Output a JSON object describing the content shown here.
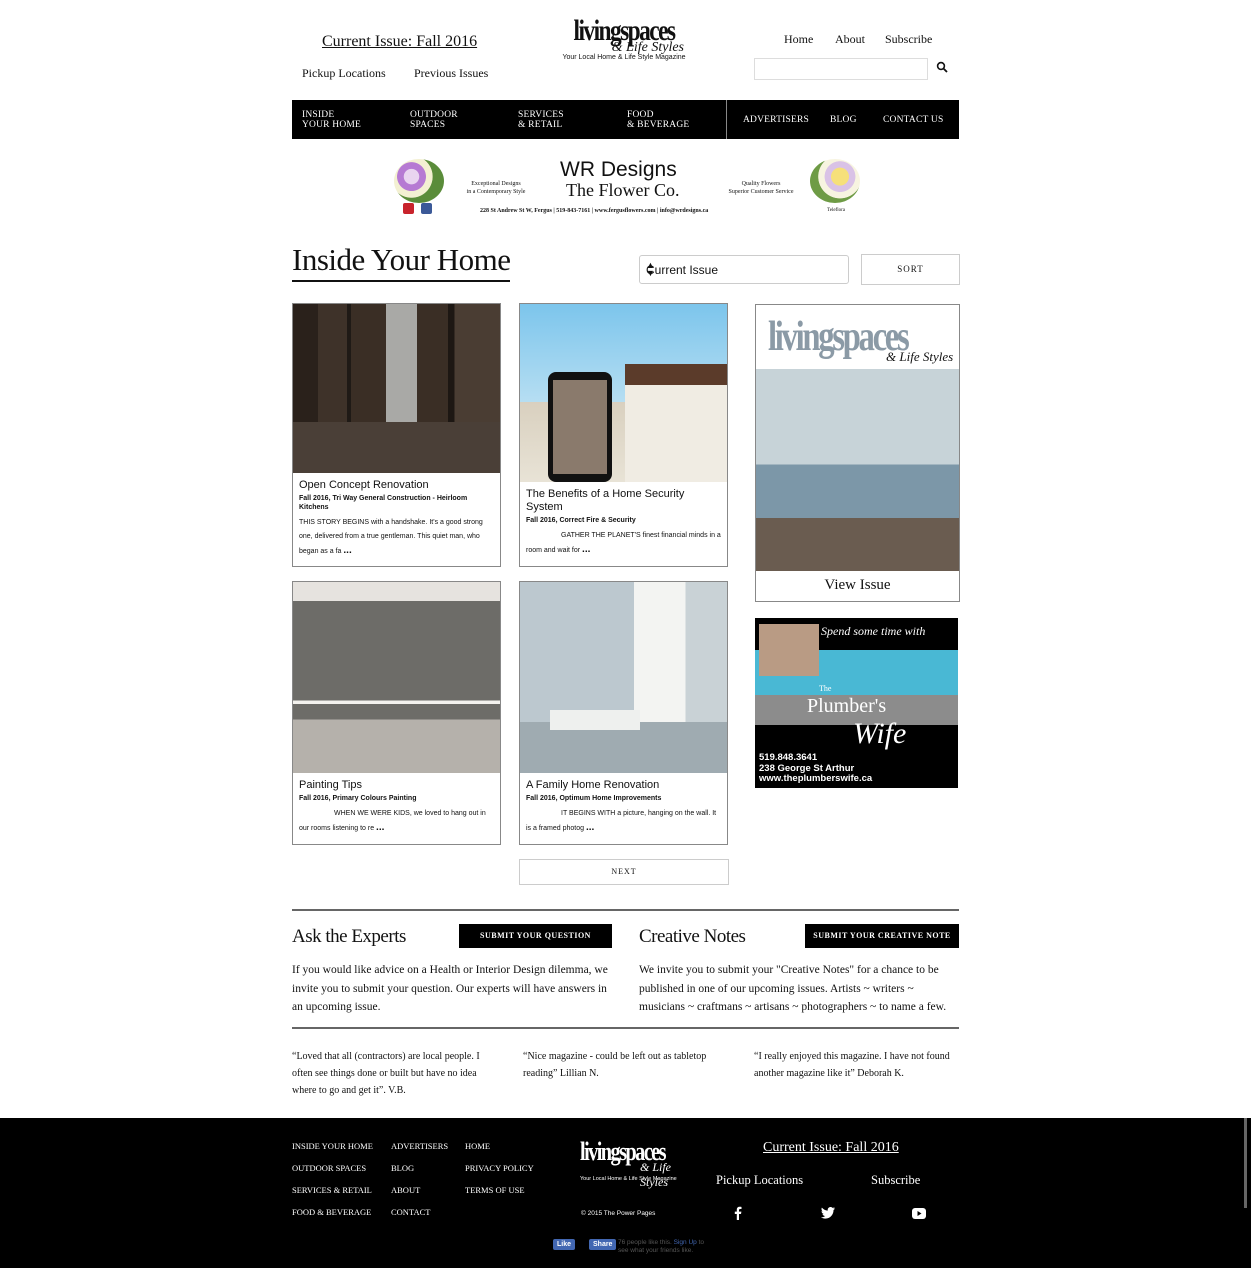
{
  "header": {
    "current_issue": "Current Issue: Fall 2016",
    "pickup_locations": "Pickup Locations",
    "previous_issues": "Previous Issues",
    "logo_word": "livingspaces",
    "logo_script": "& Life Styles",
    "logo_tagline": "Your Local Home & Life Style Magazine",
    "nav": {
      "home": "Home",
      "about": "About",
      "subscribe": "Subscribe"
    },
    "search_placeholder": ""
  },
  "navbar": {
    "inside_home_1": "INSIDE",
    "inside_home_2": "YOUR HOME",
    "outdoor_1": "OUTDOOR",
    "outdoor_2": "SPACES",
    "services_1": "SERVICES",
    "services_2": "& RETAIL",
    "food_1": "FOOD",
    "food_2": "& BEVERAGE",
    "advertisers": "ADVERTISERS",
    "blog": "BLOG",
    "contact": "CONTACT US"
  },
  "ad_banner": {
    "title": "WR Designs",
    "subtitle": "The Flower Co.",
    "left_text_1": "Exceptional Designs",
    "left_text_2": "in a Contemporary Style",
    "right_text_1": "Quality Flowers",
    "right_text_2": "Superior Customer Service",
    "address": "228 St Andrew St W, Fergus  |  519-843-7161  |  www.fergusflowers.com  |  info@wrdesigns.ca",
    "teleflora": "Teleflora"
  },
  "section": {
    "title": "Inside Your Home",
    "filter_value": "Current Issue",
    "sort_label": "SORT"
  },
  "articles": [
    {
      "title": "Open Concept Renovation",
      "meta": "Fall 2016, Tri Way General Construction - Heirloom Kitchens",
      "excerpt": "THIS STORY BEGINS with a handshake. It's a good strong one, delivered from a true gentleman. This quiet man, who began as a fa"
    },
    {
      "title": "The Benefits of a Home Security System",
      "meta": "Fall 2016, Correct Fire & Security",
      "excerpt": "GATHER THE PLANET'S finest financial minds in a room and wait for"
    },
    {
      "title": "Painting Tips",
      "meta": "Fall 2016, Primary Colours Painting",
      "excerpt": "WHEN WE WERE KIDS, we loved to hang out in our rooms listening to re"
    },
    {
      "title": "A Family Home Renovation",
      "meta": "Fall 2016, Optimum Home Improvements",
      "excerpt": "IT BEGINS WITH a picture, hanging on the wall. It is a framed photog"
    }
  ],
  "more": "...",
  "next_label": "NEXT",
  "magazine": {
    "cover_word": "livingspaces",
    "cover_script": "& Life Styles",
    "view_label": "View Issue"
  },
  "plumber_ad": {
    "headline": "Spend some time with",
    "brand_1": "The",
    "brand_2": "Plumber's",
    "brand_3": "Wife",
    "phone": "519.848.3641",
    "address": "238 George St Arthur",
    "web": "www.theplumberswife.ca"
  },
  "experts": {
    "title": "Ask the Experts",
    "button": "SUBMIT YOUR QUESTION",
    "text": "If you would like advice on a Health or Interior Design dilemma, we invite you to submit your question. Our experts will have answers in an upcoming issue."
  },
  "creative": {
    "title": "Creative Notes",
    "button": "SUBMIT YOUR CREATIVE NOTE",
    "text": "We invite you to submit your \"Creative Notes\" for a chance to be published in one of our upcoming issues. Artists ~ writers ~ musicians ~ craftmans ~ artisans ~ photographers ~ to name a few."
  },
  "quotes": [
    "“Loved that all (contractors) are local people. I often see things done or built but have no idea where to go and get it”. V.B.",
    "“Nice magazine - could be left out as tabletop reading” Lillian N.",
    "“I really enjoyed this magazine. I have not found another magazine like it” Deborah K."
  ],
  "footer": {
    "col1": [
      "INSIDE YOUR HOME",
      "OUTDOOR SPACES",
      "SERVICES & RETAIL",
      "FOOD & BEVERAGE"
    ],
    "col2": [
      "ADVERTISERS",
      "BLOG",
      "ABOUT",
      "CONTACT"
    ],
    "col3": [
      "HOME",
      "PRIVACY POLICY",
      "TERMS OF USE"
    ],
    "logo_word": "livingspaces",
    "logo_script": "& Life Styles",
    "logo_tagline": "Your Local Home & Life Style Magazine",
    "copyright": "© 2015 The Power Pages",
    "current_issue": "Current Issue: Fall 2016",
    "pickup": "Pickup Locations",
    "subscribe": "Subscribe",
    "fb_like": "Like",
    "fb_share": "Share",
    "fb_text_1": "76 people like this.",
    "fb_text_2": "Sign Up",
    "fb_text_3": "to see what your friends like."
  }
}
